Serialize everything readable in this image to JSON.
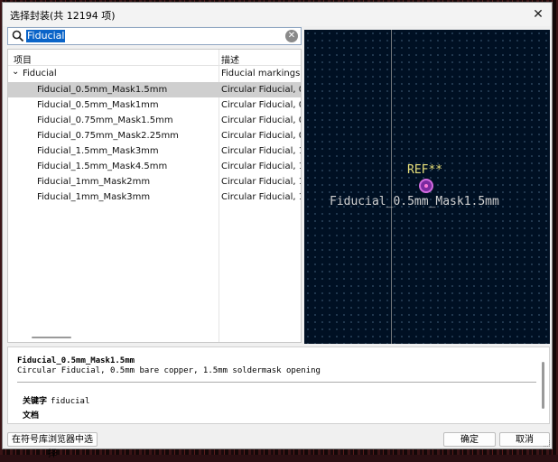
{
  "window": {
    "title": "选择封装(共 12194 项)",
    "close_symbol": "✕"
  },
  "search": {
    "value": "Fiducial",
    "icon": "search-icon",
    "clear_symbol": "✕"
  },
  "tree": {
    "columns": [
      "项目",
      "描述"
    ],
    "group": {
      "expander": "⌄",
      "label": "Fiducial",
      "description": "Fiducial markings"
    },
    "items": [
      {
        "name": "Fiducial_0.5mm_Mask1.5mm",
        "desc": "Circular Fiducial, 0.5m",
        "selected": true
      },
      {
        "name": "Fiducial_0.5mm_Mask1mm",
        "desc": "Circular Fiducial, 0.5m"
      },
      {
        "name": "Fiducial_0.75mm_Mask1.5mm",
        "desc": "Circular Fiducial, 0.75"
      },
      {
        "name": "Fiducial_0.75mm_Mask2.25mm",
        "desc": "Circular Fiducial, 0.75"
      },
      {
        "name": "Fiducial_1.5mm_Mask3mm",
        "desc": "Circular Fiducial, 1.5n"
      },
      {
        "name": "Fiducial_1.5mm_Mask4.5mm",
        "desc": "Circular Fiducial, 1.5n"
      },
      {
        "name": "Fiducial_1mm_Mask2mm",
        "desc": "Circular Fiducial, 1m"
      },
      {
        "name": "Fiducial_1mm_Mask3mm",
        "desc": "Circular Fiducial, 1m"
      }
    ]
  },
  "preview": {
    "ref": "REF**",
    "footprint_name": "Fiducial_0.5mm_Mask1.5mm"
  },
  "details": {
    "name": "Fiducial_0.5mm_Mask1.5mm",
    "description": "Circular Fiducial, 0.5mm bare copper, 1.5mm soldermask opening",
    "keywords_label": "关键字",
    "keywords_value": "fiducial",
    "docs_label": "文档"
  },
  "buttons": {
    "library_browser": "在符号库浏览器中选择",
    "ok": "确定",
    "cancel": "取消"
  }
}
